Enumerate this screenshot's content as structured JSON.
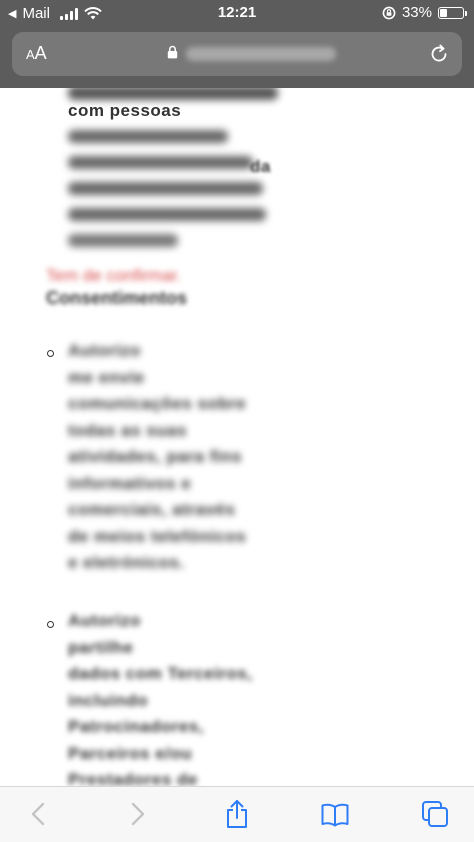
{
  "status_bar": {
    "back_app": "Mail",
    "time": "12:21",
    "battery_percent": "33%",
    "battery_level": 0.33
  },
  "address_bar": {
    "text_size_label_big": "A",
    "text_size_label_small": "A"
  },
  "content": {
    "intro_lines": [
      "com pessoas",
      "da"
    ],
    "red_link": "Tem de confirmar.",
    "section_title": "Consentimentos",
    "consent_1_lines": [
      "Autorizo",
      "me envie",
      "comunicações sobre",
      "todas as suas",
      "atividades, para fins",
      "informativos e",
      "comerciais, através",
      "de meios telefónicos",
      "e eletrónicos."
    ],
    "consent_2_lines": [
      "Autorizo",
      "partilhe",
      "dados com Terceiros,",
      "incluindo",
      "Patrocinadores,",
      "Parceiros e/ou",
      "Prestadores de"
    ]
  },
  "colors": {
    "chrome": "#5c5c5c",
    "address_bar": "#787878",
    "link_red": "#d94f4f",
    "toolbar_blue": "#2f7df6",
    "toolbar_gray": "#c4c4c4"
  }
}
